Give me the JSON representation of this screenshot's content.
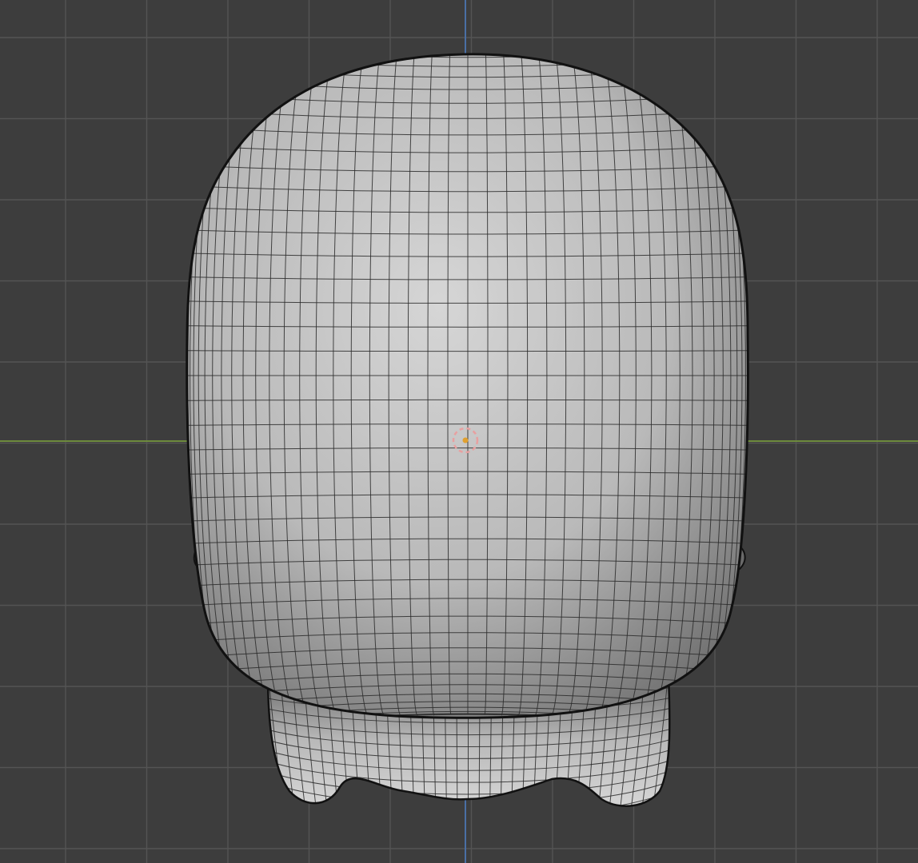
{
  "viewport": {
    "view": "back-orthographic",
    "background_color": "#3d3d3d",
    "grid": {
      "visible": true,
      "line_color": "#545454",
      "minor_line_color": "#474747",
      "x_axis_color": "#6e8b3d",
      "z_axis_color": "#4a6fa5"
    }
  },
  "mesh": {
    "object": "head-mesh",
    "shading": "solid",
    "wireframe_overlay": true,
    "surface_color": "#b9b9b9",
    "highlight_color": "#d6d6d6",
    "shadow_color": "#6a6a6a",
    "wire_color": "#2a2a2a",
    "silhouette_color": "#111111",
    "head_wire_columns": 44,
    "head_wire_rows": 46,
    "neck_wire_columns": 34,
    "neck_wire_rows": 12
  },
  "origin_marker": {
    "icon": "origin-icon",
    "color": "#e8a0a0",
    "center_color": "#e0a030"
  }
}
